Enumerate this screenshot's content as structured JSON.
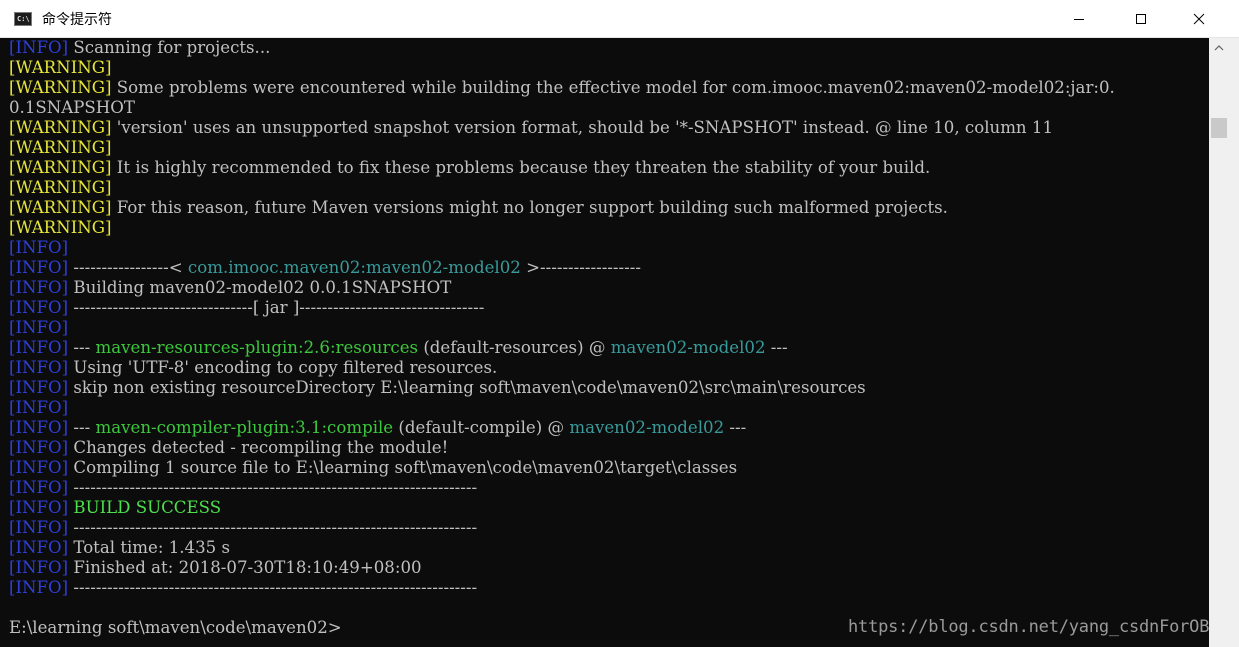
{
  "window": {
    "title": "命令提示符",
    "icon_text": "C:\\",
    "icon": "console-app-icon",
    "controls": [
      "minimize-icon",
      "maximize-icon",
      "close-icon"
    ]
  },
  "colors": {
    "background": "#0c0c0c",
    "text": "#c0c0c0",
    "info_tag": "#2f3fd8",
    "warning_tag": "#e6e63c",
    "artifact": "#3a9a9a",
    "plugin": "#3cc83c",
    "success": "#4ce04c"
  },
  "console": {
    "lines": [
      [
        {
          "t": "[INFO]",
          "c": "blue"
        },
        {
          "t": " Scanning for projects..."
        }
      ],
      [
        {
          "t": "[WARNING]",
          "c": "yellow"
        }
      ],
      [
        {
          "t": "[WARNING]",
          "c": "yellow"
        },
        {
          "t": " Some problems were encountered while building the effective model for com.imooc.maven02:maven02-model02:jar:0."
        }
      ],
      [
        {
          "t": "0.1SNAPSHOT"
        }
      ],
      [
        {
          "t": "[WARNING]",
          "c": "yellow"
        },
        {
          "t": " 'version' uses an unsupported snapshot version format, should be '*-SNAPSHOT' instead. @ line 10, column 11"
        }
      ],
      [
        {
          "t": "[WARNING]",
          "c": "yellow"
        }
      ],
      [
        {
          "t": "[WARNING]",
          "c": "yellow"
        },
        {
          "t": " It is highly recommended to fix these problems because they threaten the stability of your build."
        }
      ],
      [
        {
          "t": "[WARNING]",
          "c": "yellow"
        }
      ],
      [
        {
          "t": "[WARNING]",
          "c": "yellow"
        },
        {
          "t": " For this reason, future Maven versions might no longer support building such malformed projects."
        }
      ],
      [
        {
          "t": "[WARNING]",
          "c": "yellow"
        }
      ],
      [
        {
          "t": "[INFO]",
          "c": "blue"
        }
      ],
      [
        {
          "t": "[INFO]",
          "c": "blue"
        },
        {
          "t": " -----------------< "
        },
        {
          "t": "com.imooc.maven02:maven02-model02",
          "c": "teal"
        },
        {
          "t": " >------------------"
        }
      ],
      [
        {
          "t": "[INFO]",
          "c": "blue"
        },
        {
          "t": " Building maven02-model02 0.0.1SNAPSHOT"
        }
      ],
      [
        {
          "t": "[INFO]",
          "c": "blue"
        },
        {
          "t": " --------------------------------[ jar ]---------------------------------"
        }
      ],
      [
        {
          "t": "[INFO]",
          "c": "blue"
        }
      ],
      [
        {
          "t": "[INFO]",
          "c": "blue"
        },
        {
          "t": " --- "
        },
        {
          "t": "maven-resources-plugin:2.6:resources",
          "c": "green"
        },
        {
          "t": " (default-resources) @ "
        },
        {
          "t": "maven02-model02",
          "c": "teal"
        },
        {
          "t": " ---"
        }
      ],
      [
        {
          "t": "[INFO]",
          "c": "blue"
        },
        {
          "t": " Using 'UTF-8' encoding to copy filtered resources."
        }
      ],
      [
        {
          "t": "[INFO]",
          "c": "blue"
        },
        {
          "t": " skip non existing resourceDirectory E:\\learning soft\\maven\\code\\maven02\\src\\main\\resources"
        }
      ],
      [
        {
          "t": "[INFO]",
          "c": "blue"
        }
      ],
      [
        {
          "t": "[INFO]",
          "c": "blue"
        },
        {
          "t": " --- "
        },
        {
          "t": "maven-compiler-plugin:3.1:compile",
          "c": "green"
        },
        {
          "t": " (default-compile) @ "
        },
        {
          "t": "maven02-model02",
          "c": "teal"
        },
        {
          "t": " ---"
        }
      ],
      [
        {
          "t": "[INFO]",
          "c": "blue"
        },
        {
          "t": " Changes detected - recompiling the module!"
        }
      ],
      [
        {
          "t": "[INFO]",
          "c": "blue"
        },
        {
          "t": " Compiling 1 source file to E:\\learning soft\\maven\\code\\maven02\\target\\classes"
        }
      ],
      [
        {
          "t": "[INFO]",
          "c": "blue"
        },
        {
          "t": " ------------------------------------------------------------------------"
        }
      ],
      [
        {
          "t": "[INFO]",
          "c": "blue"
        },
        {
          "t": " "
        },
        {
          "t": "BUILD SUCCESS",
          "c": "bright-green"
        }
      ],
      [
        {
          "t": "[INFO]",
          "c": "blue"
        },
        {
          "t": " ------------------------------------------------------------------------"
        }
      ],
      [
        {
          "t": "[INFO]",
          "c": "blue"
        },
        {
          "t": " Total time: 1.435 s"
        }
      ],
      [
        {
          "t": "[INFO]",
          "c": "blue"
        },
        {
          "t": " Finished at: 2018-07-30T18:10:49+08:00"
        }
      ],
      [
        {
          "t": "[INFO]",
          "c": "blue"
        },
        {
          "t": " ------------------------------------------------------------------------"
        }
      ],
      [],
      [
        {
          "t": "E:\\learning soft\\maven\\code\\maven02>"
        }
      ]
    ]
  },
  "watermark": "https://blog.csdn.net/yang_csdnForOB"
}
